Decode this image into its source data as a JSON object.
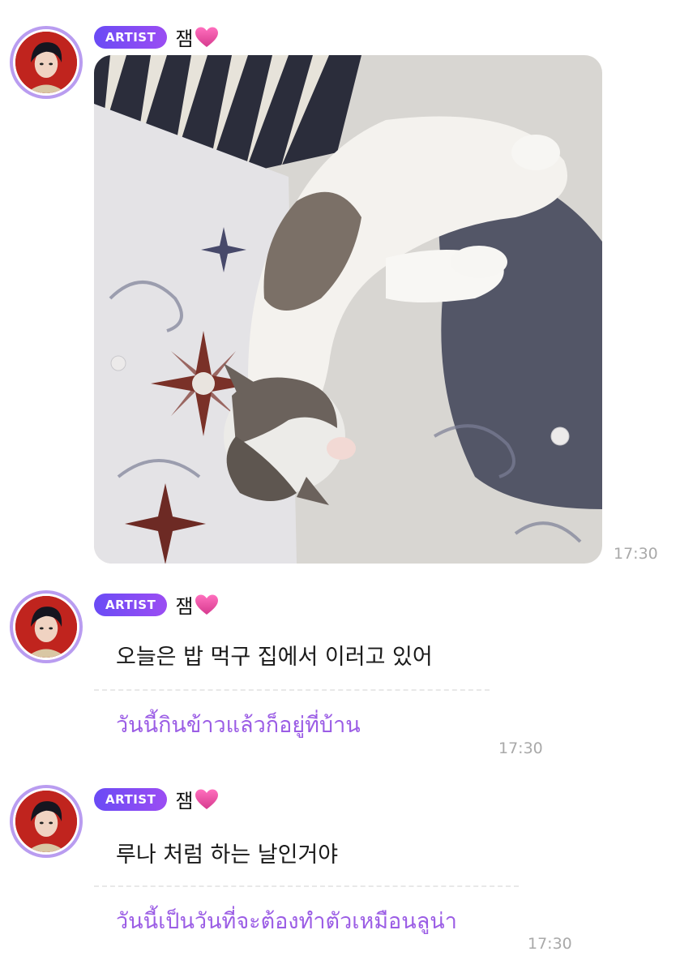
{
  "messages": [
    {
      "badge": "ARTIST",
      "name": "잼",
      "type": "image",
      "image_alt": "cat lying on patterned pillow",
      "time": "17:30"
    },
    {
      "badge": "ARTIST",
      "name": "잼",
      "type": "text",
      "text": "오늘은 밥 먹구 집에서 이러고 있어",
      "translation": "วันนี้กินข้าวแล้วก็อยู่ที่บ้าน",
      "time": "17:30"
    },
    {
      "badge": "ARTIST",
      "name": "잼",
      "type": "text",
      "text": "루나 처럼 하는 날인거야",
      "translation": "วันนี้เป็นวันที่จะต้องทำตัวเหมือนลูน่า",
      "time": "17:30"
    }
  ],
  "icons": {
    "heart": "heart-icon",
    "avatar": "avatar"
  },
  "colors": {
    "badge": "#7c4cf4",
    "translation": "#9b5de5",
    "avatar_ring": "#b99cf0",
    "heart": "#e0479b"
  }
}
